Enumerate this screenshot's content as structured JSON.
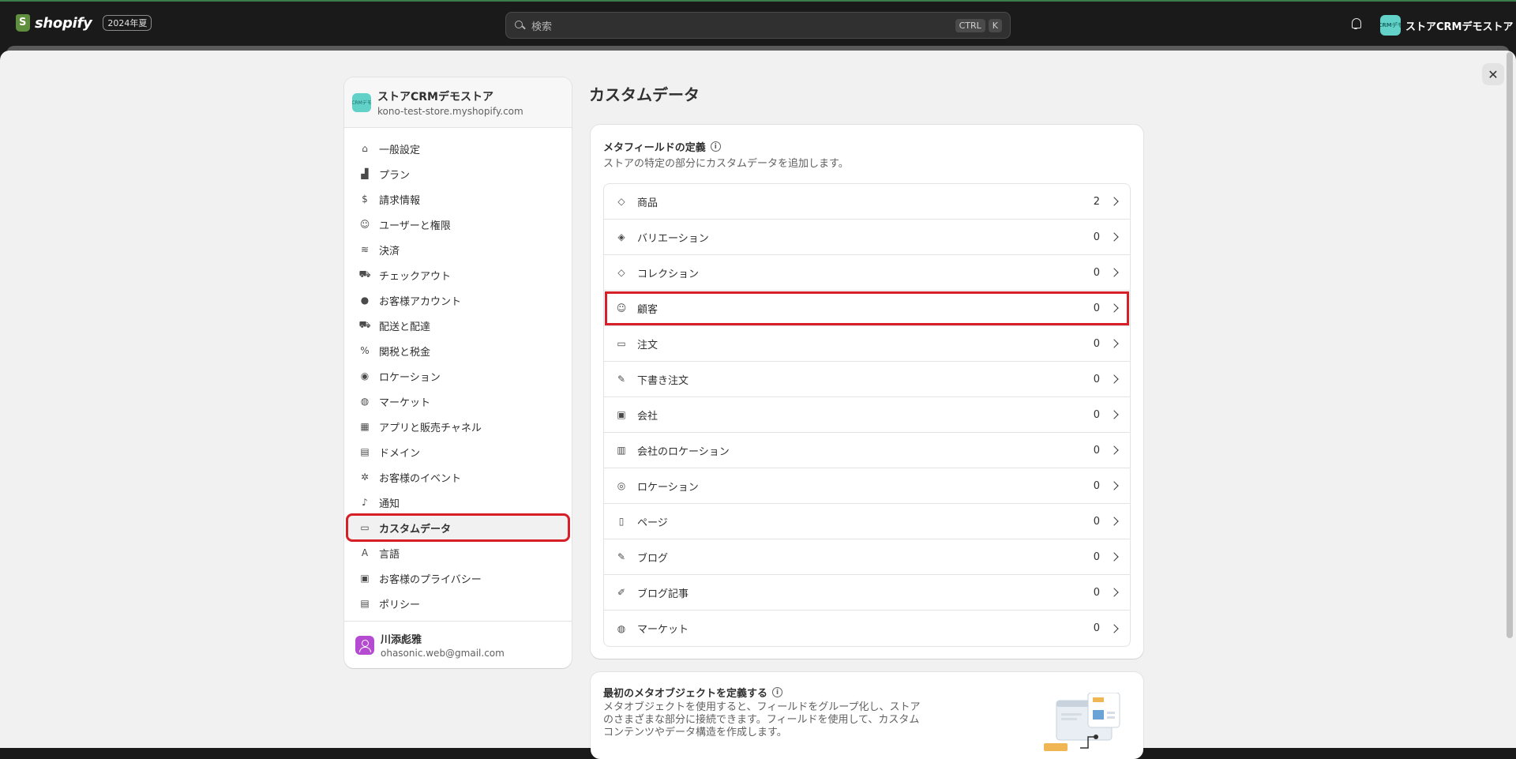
{
  "topbar": {
    "brand": "shopify",
    "edition": "2024年夏",
    "search_placeholder": "検索",
    "shortcut_key1": "CTRL",
    "shortcut_key2": "K",
    "store_name": "ストアCRMデモストア",
    "store_avatar_text": "CRMデモ"
  },
  "sidebar": {
    "store_name": "ストアCRMデモストア",
    "store_domain": "kono-test-store.myshopify.com",
    "store_avatar_text": "CRMデモ",
    "items": [
      {
        "label": "一般設定",
        "icon": "store-icon",
        "glyph": "⌂"
      },
      {
        "label": "プラン",
        "icon": "plan-icon",
        "glyph": "▟"
      },
      {
        "label": "請求情報",
        "icon": "billing-icon",
        "glyph": "$"
      },
      {
        "label": "ユーザーと権限",
        "icon": "users-icon",
        "glyph": "☺"
      },
      {
        "label": "決済",
        "icon": "payments-icon",
        "glyph": "≋"
      },
      {
        "label": "チェックアウト",
        "icon": "cart-icon",
        "glyph": "⛟"
      },
      {
        "label": "お客様アカウント",
        "icon": "person-icon",
        "glyph": "●"
      },
      {
        "label": "配送と配達",
        "icon": "truck-icon",
        "glyph": "⛟"
      },
      {
        "label": "関税と税金",
        "icon": "tax-icon",
        "glyph": "%"
      },
      {
        "label": "ロケーション",
        "icon": "location-icon",
        "glyph": "◉"
      },
      {
        "label": "マーケット",
        "icon": "globe-icon",
        "glyph": "◍"
      },
      {
        "label": "アプリと販売チャネル",
        "icon": "apps-icon",
        "glyph": "▦"
      },
      {
        "label": "ドメイン",
        "icon": "domain-icon",
        "glyph": "▤"
      },
      {
        "label": "お客様のイベント",
        "icon": "cursor-icon",
        "glyph": "✲"
      },
      {
        "label": "通知",
        "icon": "bell-icon",
        "glyph": "♪"
      },
      {
        "label": "カスタムデータ",
        "icon": "metafield-icon",
        "glyph": "▭",
        "active": true
      },
      {
        "label": "言語",
        "icon": "language-icon",
        "glyph": "A"
      },
      {
        "label": "お客様のプライバシー",
        "icon": "lock-icon",
        "glyph": "▣"
      },
      {
        "label": "ポリシー",
        "icon": "policy-icon",
        "glyph": "▤"
      }
    ],
    "user_name": "川添彪雅",
    "user_email": "ohasonic.web@gmail.com"
  },
  "main": {
    "title": "カスタムデータ",
    "close_label": "✕",
    "metafields": {
      "title": "メタフィールドの定義",
      "subtitle": "ストアの特定の部分にカスタムデータを追加します。",
      "rows": [
        {
          "label": "商品",
          "count": "2",
          "icon": "tag-icon",
          "glyph": "◇"
        },
        {
          "label": "バリエーション",
          "count": "0",
          "icon": "variant-icon",
          "glyph": "◈"
        },
        {
          "label": "コレクション",
          "count": "0",
          "icon": "collection-icon",
          "glyph": "◇"
        },
        {
          "label": "顧客",
          "count": "0",
          "icon": "person-icon",
          "glyph": "☺",
          "highlight": true
        },
        {
          "label": "注文",
          "count": "0",
          "icon": "inbox-icon",
          "glyph": "▭"
        },
        {
          "label": "下書き注文",
          "count": "0",
          "icon": "draft-icon",
          "glyph": "✎"
        },
        {
          "label": "会社",
          "count": "0",
          "icon": "company-icon",
          "glyph": "▣"
        },
        {
          "label": "会社のロケーション",
          "count": "0",
          "icon": "building-icon",
          "glyph": "▥"
        },
        {
          "label": "ロケーション",
          "count": "0",
          "icon": "location-icon",
          "glyph": "◎"
        },
        {
          "label": "ページ",
          "count": "0",
          "icon": "page-icon",
          "glyph": "▯"
        },
        {
          "label": "ブログ",
          "count": "0",
          "icon": "blog-icon",
          "glyph": "✎"
        },
        {
          "label": "ブログ記事",
          "count": "0",
          "icon": "pencil-icon",
          "glyph": "✐"
        },
        {
          "label": "マーケット",
          "count": "0",
          "icon": "globe-icon",
          "glyph": "◍"
        }
      ]
    },
    "metaobjects": {
      "title": "最初のメタオブジェクトを定義する",
      "description": "メタオブジェクトを使用すると、フィールドをグループ化し、ストアのさまざまな部分に接続できます。フィールドを使用して、カスタムコンテンツやデータ構造を作成します。"
    }
  },
  "colors": {
    "topbar_bg": "#1a1a1a",
    "panel_bg": "#f1f1f1",
    "highlight_red": "#d61f26",
    "store_avatar": "#62d2c9",
    "user_avatar": "#b44bd1"
  }
}
